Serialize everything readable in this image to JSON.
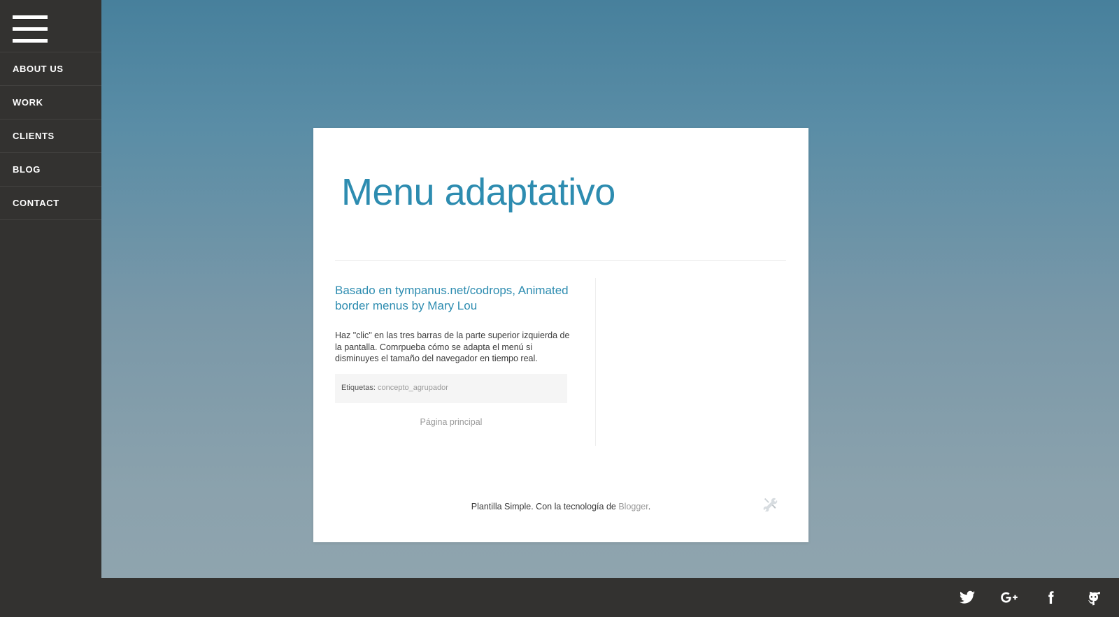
{
  "sidebar": {
    "menu_toggle_label": "menu",
    "items": [
      {
        "label": "ABOUT US"
      },
      {
        "label": "WORK"
      },
      {
        "label": "CLIENTS"
      },
      {
        "label": "BLOG"
      },
      {
        "label": "CONTACT"
      }
    ]
  },
  "page": {
    "blog_title": "Menu adaptativo"
  },
  "post": {
    "title": "Basado en tympanus.net/codrops, Animated border menus by Mary Lou",
    "body": "Haz \"clic\" en las tres barras de la parte superior izquierda de la pantalla. Comrpueba cómo se adapta el menú si disminuyes el tamaño del navegador en tiempo real.",
    "labels_prefix": "Etiquetas:",
    "labels_value": "concepto_agrupador",
    "home_link": "Página principal"
  },
  "footer": {
    "attribution": "Plantilla Simple. Con la tecnología de ",
    "attribution_link": "Blogger",
    "attribution_end": ".",
    "tools_icon": "tools-icon"
  },
  "social": [
    {
      "name": "twitter-icon"
    },
    {
      "name": "google-plus-icon"
    },
    {
      "name": "facebook-icon"
    },
    {
      "name": "github-icon"
    }
  ],
  "colors": {
    "accent": "#2d8cb0",
    "dark": "#333230",
    "bg_top": "#47809c",
    "bg_bottom": "#8ba2ad"
  }
}
